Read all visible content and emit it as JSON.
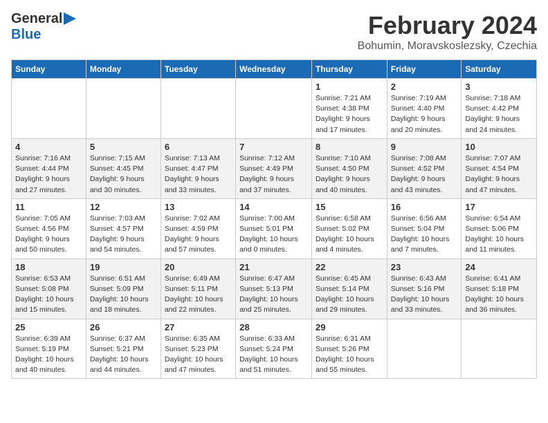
{
  "header": {
    "logo_general": "General",
    "logo_blue": "Blue",
    "title": "February 2024",
    "subtitle": "Bohumin, Moravskoslezsky, Czechia"
  },
  "weekdays": [
    "Sunday",
    "Monday",
    "Tuesday",
    "Wednesday",
    "Thursday",
    "Friday",
    "Saturday"
  ],
  "weeks": [
    [
      {
        "day": "",
        "sunrise": "",
        "sunset": "",
        "daylight": ""
      },
      {
        "day": "",
        "sunrise": "",
        "sunset": "",
        "daylight": ""
      },
      {
        "day": "",
        "sunrise": "",
        "sunset": "",
        "daylight": ""
      },
      {
        "day": "",
        "sunrise": "",
        "sunset": "",
        "daylight": ""
      },
      {
        "day": "1",
        "sunrise": "Sunrise: 7:21 AM",
        "sunset": "Sunset: 4:38 PM",
        "daylight": "Daylight: 9 hours and 17 minutes."
      },
      {
        "day": "2",
        "sunrise": "Sunrise: 7:19 AM",
        "sunset": "Sunset: 4:40 PM",
        "daylight": "Daylight: 9 hours and 20 minutes."
      },
      {
        "day": "3",
        "sunrise": "Sunrise: 7:18 AM",
        "sunset": "Sunset: 4:42 PM",
        "daylight": "Daylight: 9 hours and 24 minutes."
      }
    ],
    [
      {
        "day": "4",
        "sunrise": "Sunrise: 7:16 AM",
        "sunset": "Sunset: 4:44 PM",
        "daylight": "Daylight: 9 hours and 27 minutes."
      },
      {
        "day": "5",
        "sunrise": "Sunrise: 7:15 AM",
        "sunset": "Sunset: 4:45 PM",
        "daylight": "Daylight: 9 hours and 30 minutes."
      },
      {
        "day": "6",
        "sunrise": "Sunrise: 7:13 AM",
        "sunset": "Sunset: 4:47 PM",
        "daylight": "Daylight: 9 hours and 33 minutes."
      },
      {
        "day": "7",
        "sunrise": "Sunrise: 7:12 AM",
        "sunset": "Sunset: 4:49 PM",
        "daylight": "Daylight: 9 hours and 37 minutes."
      },
      {
        "day": "8",
        "sunrise": "Sunrise: 7:10 AM",
        "sunset": "Sunset: 4:50 PM",
        "daylight": "Daylight: 9 hours and 40 minutes."
      },
      {
        "day": "9",
        "sunrise": "Sunrise: 7:08 AM",
        "sunset": "Sunset: 4:52 PM",
        "daylight": "Daylight: 9 hours and 43 minutes."
      },
      {
        "day": "10",
        "sunrise": "Sunrise: 7:07 AM",
        "sunset": "Sunset: 4:54 PM",
        "daylight": "Daylight: 9 hours and 47 minutes."
      }
    ],
    [
      {
        "day": "11",
        "sunrise": "Sunrise: 7:05 AM",
        "sunset": "Sunset: 4:56 PM",
        "daylight": "Daylight: 9 hours and 50 minutes."
      },
      {
        "day": "12",
        "sunrise": "Sunrise: 7:03 AM",
        "sunset": "Sunset: 4:57 PM",
        "daylight": "Daylight: 9 hours and 54 minutes."
      },
      {
        "day": "13",
        "sunrise": "Sunrise: 7:02 AM",
        "sunset": "Sunset: 4:59 PM",
        "daylight": "Daylight: 9 hours and 57 minutes."
      },
      {
        "day": "14",
        "sunrise": "Sunrise: 7:00 AM",
        "sunset": "Sunset: 5:01 PM",
        "daylight": "Daylight: 10 hours and 0 minutes."
      },
      {
        "day": "15",
        "sunrise": "Sunrise: 6:58 AM",
        "sunset": "Sunset: 5:02 PM",
        "daylight": "Daylight: 10 hours and 4 minutes."
      },
      {
        "day": "16",
        "sunrise": "Sunrise: 6:56 AM",
        "sunset": "Sunset: 5:04 PM",
        "daylight": "Daylight: 10 hours and 7 minutes."
      },
      {
        "day": "17",
        "sunrise": "Sunrise: 6:54 AM",
        "sunset": "Sunset: 5:06 PM",
        "daylight": "Daylight: 10 hours and 11 minutes."
      }
    ],
    [
      {
        "day": "18",
        "sunrise": "Sunrise: 6:53 AM",
        "sunset": "Sunset: 5:08 PM",
        "daylight": "Daylight: 10 hours and 15 minutes."
      },
      {
        "day": "19",
        "sunrise": "Sunrise: 6:51 AM",
        "sunset": "Sunset: 5:09 PM",
        "daylight": "Daylight: 10 hours and 18 minutes."
      },
      {
        "day": "20",
        "sunrise": "Sunrise: 6:49 AM",
        "sunset": "Sunset: 5:11 PM",
        "daylight": "Daylight: 10 hours and 22 minutes."
      },
      {
        "day": "21",
        "sunrise": "Sunrise: 6:47 AM",
        "sunset": "Sunset: 5:13 PM",
        "daylight": "Daylight: 10 hours and 25 minutes."
      },
      {
        "day": "22",
        "sunrise": "Sunrise: 6:45 AM",
        "sunset": "Sunset: 5:14 PM",
        "daylight": "Daylight: 10 hours and 29 minutes."
      },
      {
        "day": "23",
        "sunrise": "Sunrise: 6:43 AM",
        "sunset": "Sunset: 5:16 PM",
        "daylight": "Daylight: 10 hours and 33 minutes."
      },
      {
        "day": "24",
        "sunrise": "Sunrise: 6:41 AM",
        "sunset": "Sunset: 5:18 PM",
        "daylight": "Daylight: 10 hours and 36 minutes."
      }
    ],
    [
      {
        "day": "25",
        "sunrise": "Sunrise: 6:39 AM",
        "sunset": "Sunset: 5:19 PM",
        "daylight": "Daylight: 10 hours and 40 minutes."
      },
      {
        "day": "26",
        "sunrise": "Sunrise: 6:37 AM",
        "sunset": "Sunset: 5:21 PM",
        "daylight": "Daylight: 10 hours and 44 minutes."
      },
      {
        "day": "27",
        "sunrise": "Sunrise: 6:35 AM",
        "sunset": "Sunset: 5:23 PM",
        "daylight": "Daylight: 10 hours and 47 minutes."
      },
      {
        "day": "28",
        "sunrise": "Sunrise: 6:33 AM",
        "sunset": "Sunset: 5:24 PM",
        "daylight": "Daylight: 10 hours and 51 minutes."
      },
      {
        "day": "29",
        "sunrise": "Sunrise: 6:31 AM",
        "sunset": "Sunset: 5:26 PM",
        "daylight": "Daylight: 10 hours and 55 minutes."
      },
      {
        "day": "",
        "sunrise": "",
        "sunset": "",
        "daylight": ""
      },
      {
        "day": "",
        "sunrise": "",
        "sunset": "",
        "daylight": ""
      }
    ]
  ]
}
